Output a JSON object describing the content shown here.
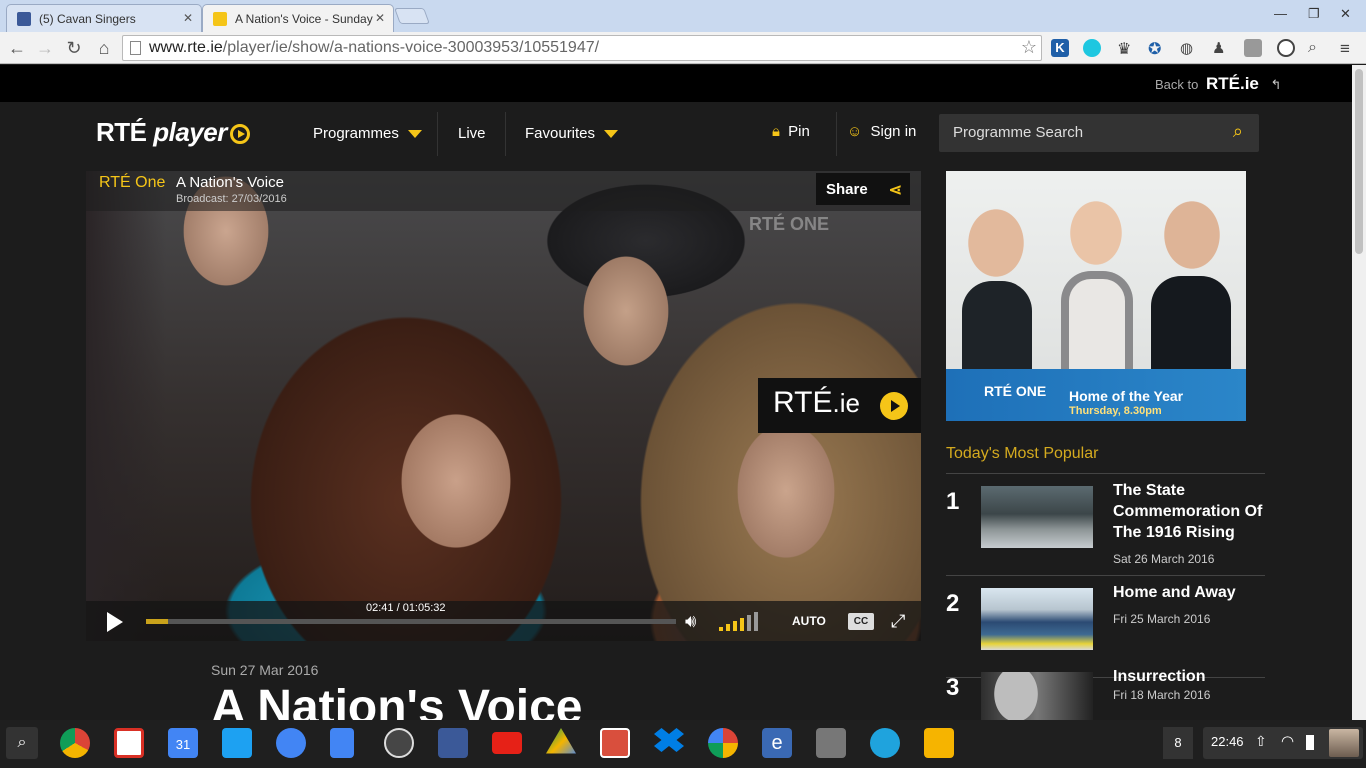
{
  "browser": {
    "tabs": [
      {
        "title": "(5) Cavan Singers",
        "favicon": "facebook-icon",
        "color": "#3b5998"
      },
      {
        "title": "A Nation's Voice - Sunday",
        "favicon": "rte-player-icon",
        "color": "#f5c518"
      }
    ],
    "url_host": "www.rte.ie",
    "url_path": "/player/ie/show/a-nations-voice-30003953/10551947/"
  },
  "site": {
    "back_label": "Back to",
    "back_logo": "RTÉ.ie",
    "brand_rte": "RTÉ",
    "brand_player": "player",
    "nav": {
      "programmes": "Programmes",
      "live": "Live",
      "favourites": "Favourites",
      "pin": "Pin",
      "sign_in": "Sign in"
    },
    "search_placeholder": "Programme Search",
    "accent_color": "#f5c518"
  },
  "player": {
    "channel": "RTÉ One",
    "title": "A Nation's Voice",
    "broadcast": "Broadcast: 27/03/2016",
    "share_label": "Share",
    "watermark": "RTÉ ONE",
    "logo_rte": "RTÉ",
    "logo_ie": ".ie",
    "time": "02:41 / 01:05:32",
    "progress": 0.041,
    "quality": "AUTO",
    "cc_label": "CC"
  },
  "episode": {
    "date": "Sun 27 Mar 2016",
    "title": "A Nation's Voice"
  },
  "promo": {
    "channel": "RTÉ ONE",
    "show": "Home of the Year",
    "when": "Thursday, 8.30pm"
  },
  "popular": {
    "heading": "Today's Most Popular",
    "items": [
      {
        "rank": "1",
        "title": "The State Commemoration Of The 1916 Rising",
        "date": "Sat 26 March 2016"
      },
      {
        "rank": "2",
        "title": "Home and Away",
        "date": "Fri 25 March 2016"
      },
      {
        "rank": "3",
        "title": "Insurrection",
        "date": "Fri 18 March 2016"
      }
    ]
  },
  "taskbar": {
    "notifications": "8",
    "clock": "22:46",
    "apps": [
      "chrome-icon",
      "gmail-icon",
      "calendar-icon",
      "twitter-icon",
      "files-icon",
      "docs-icon",
      "wordpress-icon",
      "facebook-icon",
      "youtube-icon",
      "drive-icon",
      "bookmark-icon",
      "dropbox-icon",
      "picasa-icon",
      "edge-icon",
      "calculator-icon",
      "camera-icon",
      "keep-icon"
    ],
    "calendar_day": "31"
  }
}
